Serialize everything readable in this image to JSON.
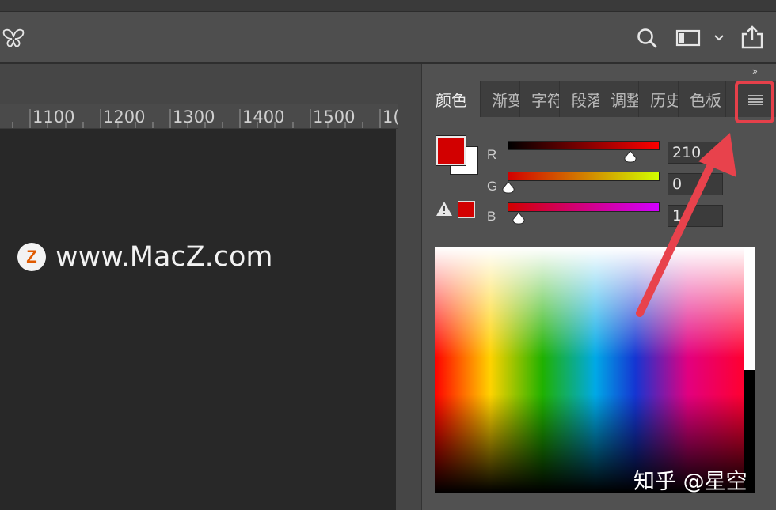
{
  "rulers": {
    "labels": [
      "1100",
      "1200",
      "1300",
      "1400",
      "1500",
      "1("
    ]
  },
  "watermark": {
    "logo_letter": "Z",
    "site": "www.MacZ.com",
    "corner": "知乎 @星空"
  },
  "panel": {
    "collapse_glyph": "››",
    "tabs": [
      {
        "label": "颜色",
        "active": true
      },
      {
        "label": "渐变",
        "active": false
      },
      {
        "label": "字符",
        "active": false
      },
      {
        "label": "段落",
        "active": false
      },
      {
        "label": "调整",
        "active": false
      },
      {
        "label": "历史",
        "active": false
      },
      {
        "label": "色板",
        "active": false
      }
    ],
    "menu_icon": "hamburger-menu-icon"
  },
  "color_panel": {
    "foreground": "#d20000",
    "background": "#ffffff",
    "channels": [
      {
        "name": "R",
        "value": "210",
        "level": 0.82
      },
      {
        "name": "G",
        "value": "0",
        "level": 0.0
      },
      {
        "name": "B",
        "value": "1",
        "level": 0.05
      }
    ]
  },
  "toolbar_icons": [
    "butterfly-icon",
    "search-icon",
    "workspace-icon",
    "chevron-down-icon",
    "share-icon"
  ],
  "colors": {
    "accent_highlight": "#e5404a",
    "arrow": "#e8424c"
  }
}
